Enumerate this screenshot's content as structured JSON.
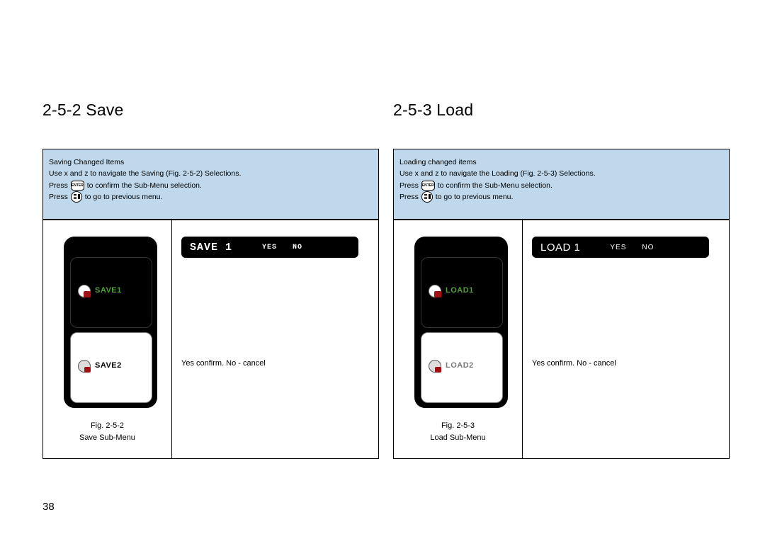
{
  "page_number": "38",
  "left": {
    "heading": "2-5-2 Save",
    "info": {
      "line1": "Saving Changed Items",
      "line2a": "Use  x  and   z  to navigate the Saving (Fig. 2-5-2) Selections.",
      "line3a": "Press",
      "line3b": "to confirm the Sub-Menu selection.",
      "line4a": "Press",
      "line4b": "to go to previous menu."
    },
    "bar": {
      "title": "SAVE 1",
      "opt1": "YES",
      "opt2": "NO"
    },
    "slot1_label": "SAVE1",
    "slot2_label": "SAVE2",
    "right_text": "Yes   confirm. No - cancel",
    "caption_fig": "Fig. 2-5-2",
    "caption_name": "Save Sub-Menu"
  },
  "right": {
    "heading": "2-5-3 Load",
    "info": {
      "line1": "Loading changed items",
      "line2a": "Use  x  and   z  to navigate the Loading (Fig. 2-5-3) Selections.",
      "line3a": "Press",
      "line3b": "to confirm the Sub-Menu selection.",
      "line4a": "Press",
      "line4b": "to go to previous menu."
    },
    "bar": {
      "title": "LOAD 1",
      "opt1": "YES",
      "opt2": "NO"
    },
    "slot1_label": "LOAD1",
    "slot2_label": "LOAD2",
    "right_text": "Yes   confirm. No - cancel",
    "caption_fig": "Fig. 2-5-3",
    "caption_name": "Load Sub-Menu"
  }
}
